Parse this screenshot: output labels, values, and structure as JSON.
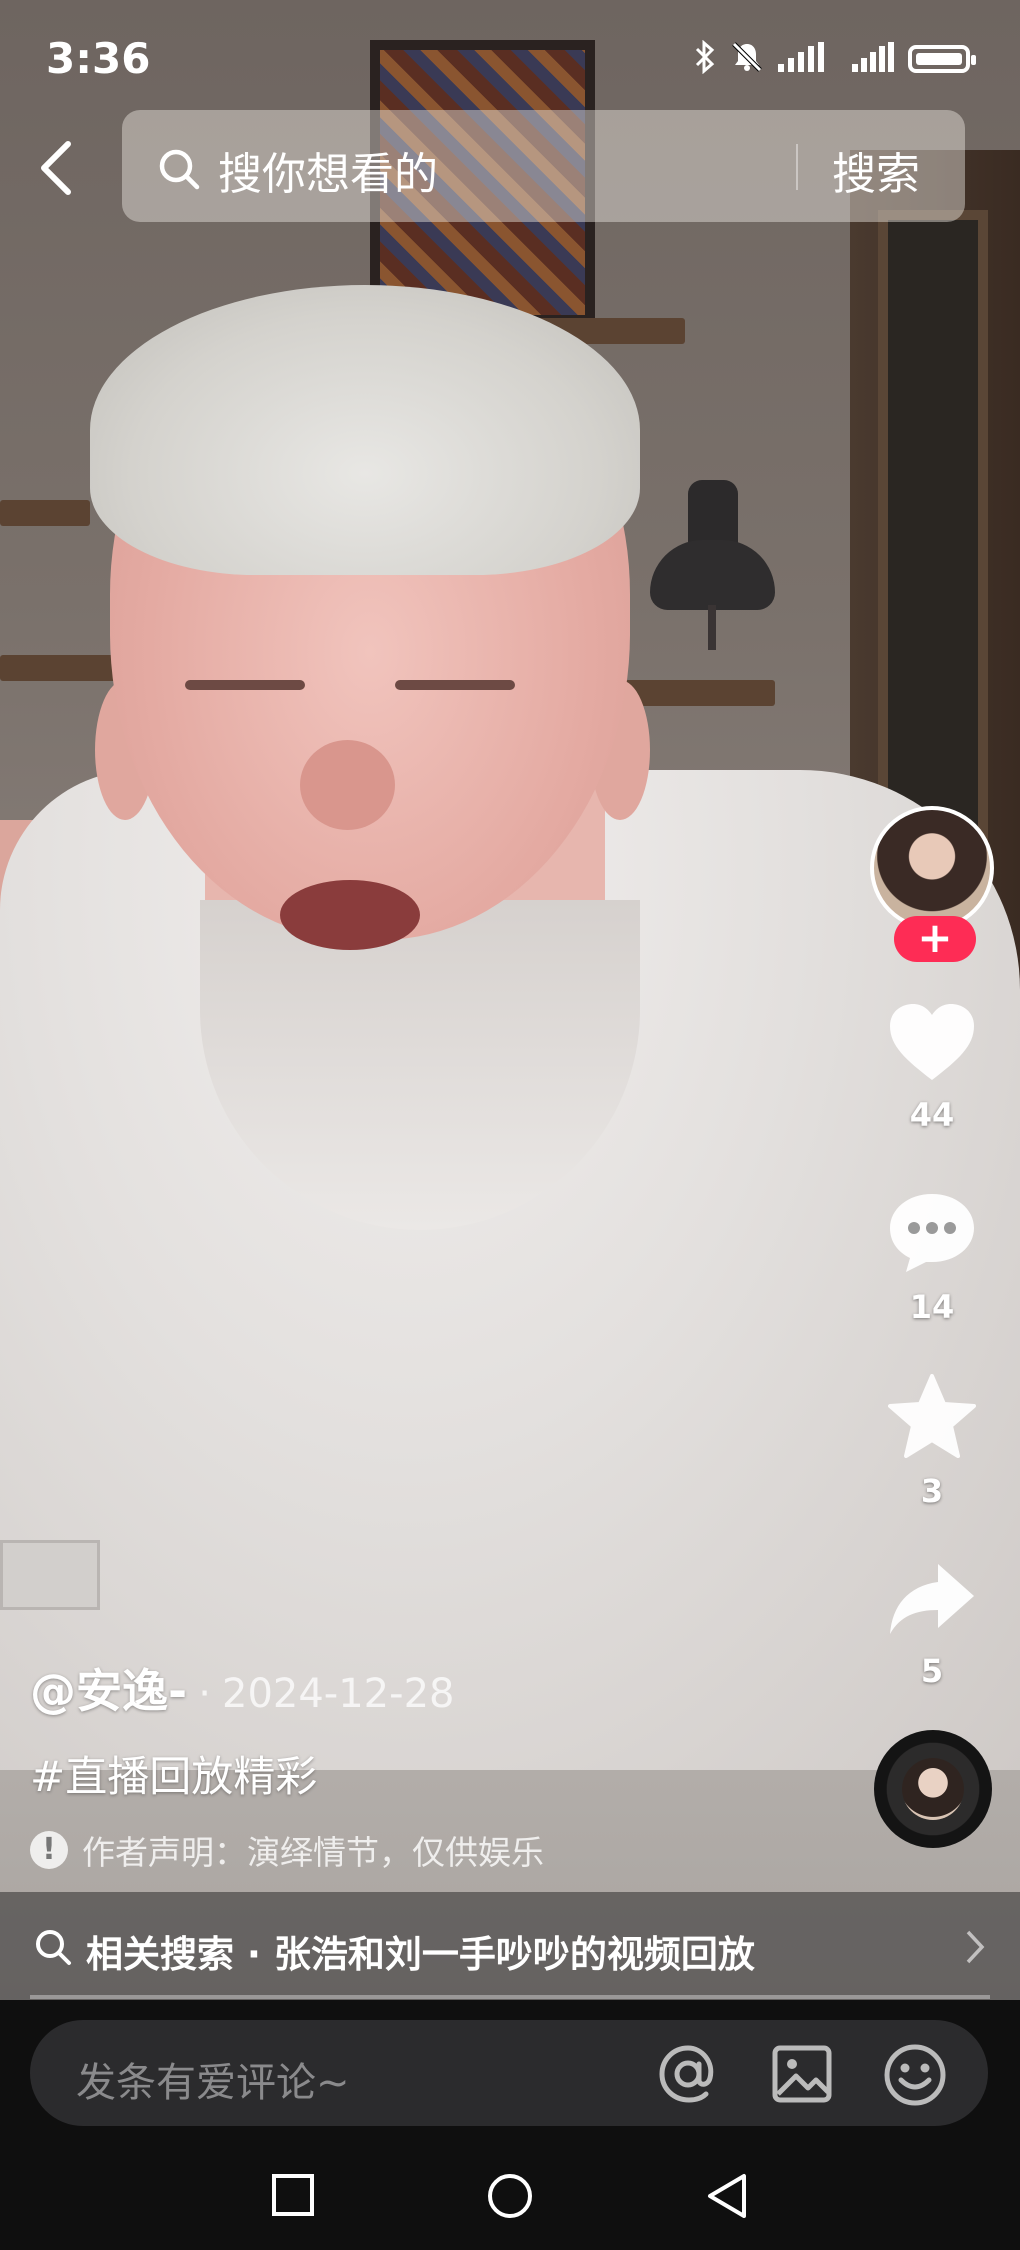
{
  "status_bar": {
    "time": "3:36"
  },
  "top_bar": {
    "search_placeholder": "搜你想看的",
    "search_button": "搜索"
  },
  "actions": {
    "likes": "44",
    "comments": "14",
    "favorites": "3",
    "shares": "5",
    "follow_symbol": "+"
  },
  "video_info": {
    "author": "@安逸-",
    "separator": "·",
    "date": "2024-12-28",
    "hashtag": "#直播回放精彩",
    "notice_icon": "!",
    "notice": "作者声明：演绎情节，仅供娱乐"
  },
  "related_search": {
    "text": "相关搜索 · 张浩和刘一手吵吵的视频回放"
  },
  "comment_bar": {
    "placeholder": "发条有爱评论~"
  },
  "icons": {
    "status": [
      "bluetooth-icon",
      "mute-icon",
      "signal-icon",
      "battery-icon"
    ],
    "comment_bar": [
      "at-icon",
      "image-icon",
      "emoji-icon"
    ],
    "nav": [
      "recent-apps-icon",
      "home-icon",
      "back-nav-icon"
    ]
  },
  "colors": {
    "follow_accent": "#fe2c55",
    "bottom_bg": "#0f0f0f"
  }
}
